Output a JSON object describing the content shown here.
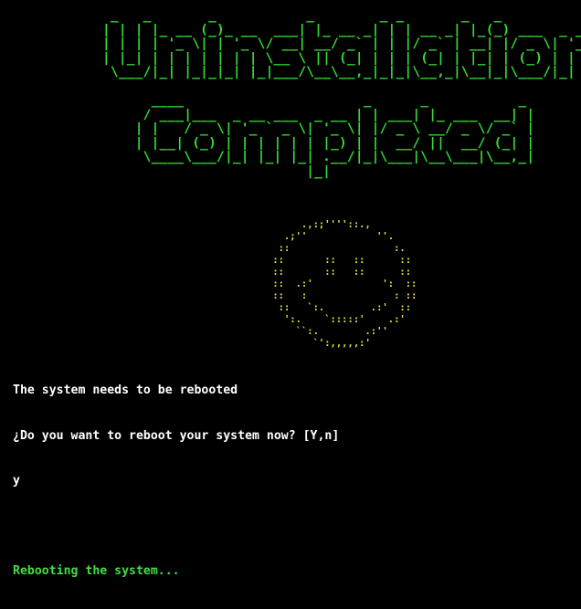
{
  "colors": {
    "background": "#000000",
    "banner": "#33dd33",
    "smiley": "#e8e040",
    "prompt_text": "#ffffff",
    "status_text": "#44dd44"
  },
  "banner": {
    "lines": [
      " _   _       _           _        _ _       _   _             ",
      "| | | |_ __ (_)_ __  ___| |_ __ _| | | __ _| |_(_) ___  _ __  ",
      "| | | | '_ \\| | '_ \\/ __| __/ _` | | |/ _` | __| |/ _ \\| '_ \\ ",
      "| |_| | | | | | | | \\__ \\ || (_| | | | (_| | |_| | (_) | | | |",
      " \\___/|_| |_|_|_| |_|___/\\__\\__,_|_|_|\\__,_|\\__|_|\\___/|_| |_|",
      "",
      "      ____                      _      _           _ ",
      "     / ___|___  _ __ ___  _ __ | | ___| |_ ___  __| |",
      "    | |   / _ \\| '_ ` _ \\| '_ \\| |/ _ \\ __/ _ \\/ _` |",
      "    | |__| (_) | | | | | | |_) | |  __/ ||  __/ (_| |",
      "     \\____\\___/|_| |_| |_| .__/|_|\\___|\\__\\___|\\__,_|",
      "                         |_|                         "
    ]
  },
  "smiley": {
    "lines": [
      "      .,:;''''::.,",
      "   .;''            ''.",
      "  ::                  :.",
      " ::       ::   ::      ::",
      " ::       ::   ::      ::",
      " ::  .:'            ':  ::",
      " ::   :               : ::",
      "  ::   `:.        .:'  ::",
      "   ':.    `:::::'    .:'",
      "     ``:.        .:''",
      "        `':,,,,,:'"
    ]
  },
  "console": {
    "line1": "The system needs to be rebooted",
    "line2": "¿Do you want to reboot your system now? [Y,n]",
    "line3": "y",
    "status": "Rebooting the system..."
  }
}
